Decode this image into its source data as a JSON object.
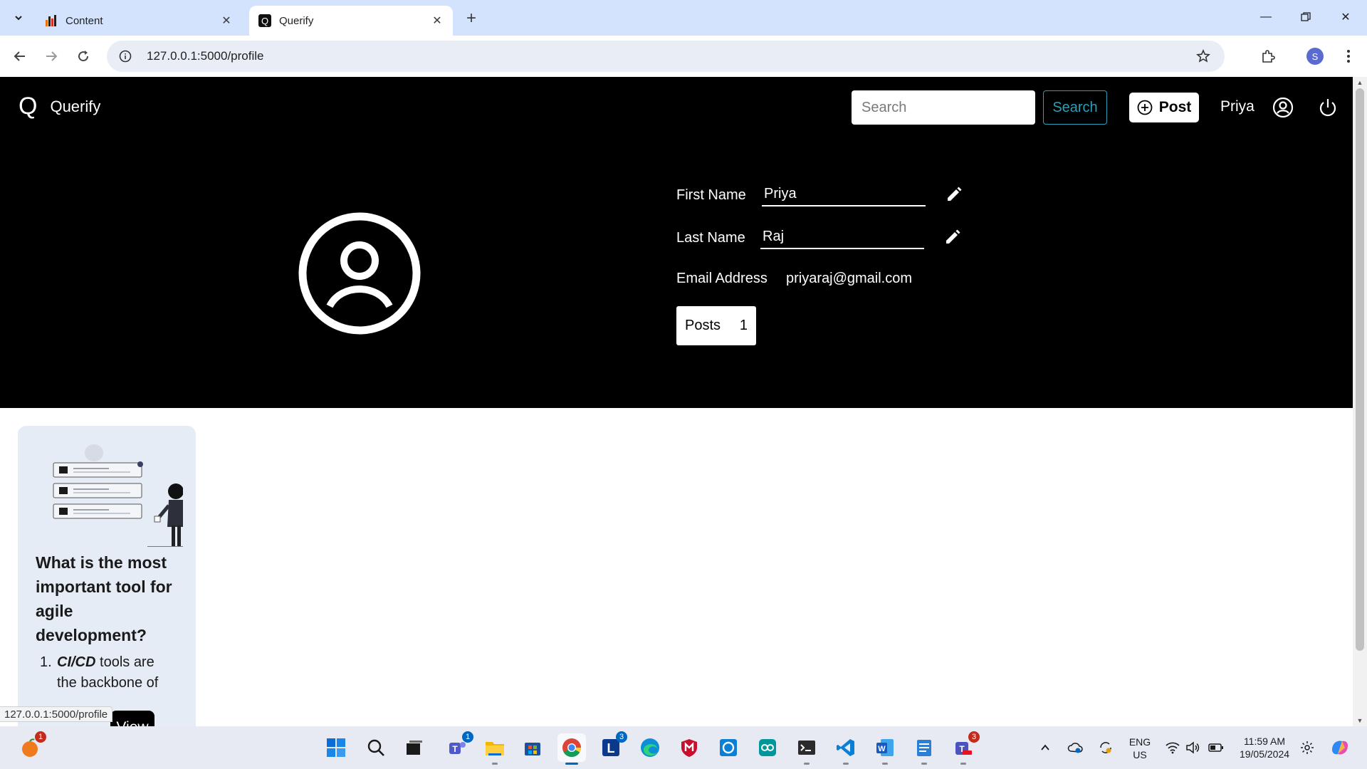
{
  "browser": {
    "tabs": [
      {
        "title": "Content",
        "icon": "bar-chart-icon"
      },
      {
        "title": "Querify",
        "icon": "querify-q-icon"
      }
    ],
    "url": "127.0.0.1:5000/profile",
    "profile_initial": "S",
    "status_url": "127.0.0.1:5000/profile"
  },
  "app": {
    "brand_logo": "Q",
    "brand_name": "Querify",
    "search_placeholder": "Search",
    "search_button": "Search",
    "post_button": "Post",
    "user_name": "Priya"
  },
  "profile": {
    "first_name_label": "First Name",
    "first_name": "Priya",
    "last_name_label": "Last Name",
    "last_name": "Raj",
    "email_label": "Email Address",
    "email": "priyaraj@gmail.com",
    "posts_label": "Posts",
    "posts_count": "1"
  },
  "card": {
    "title": "What is the most important tool for agile development?",
    "list_number": "1.",
    "list_bold": "CI/CD",
    "list_text": " tools are the backbone of",
    "view_button": "View"
  },
  "taskbar": {
    "lang_top": "ENG",
    "lang_bottom": "US",
    "time": "11:59 AM",
    "date": "19/05/2024",
    "badges": {
      "fruit": "1",
      "teams": "1",
      "l_app": "3",
      "teams2": "3"
    }
  },
  "colors": {
    "nav_bg": "#000000",
    "accent": "#2aa0b8",
    "card_bg": "#e6ecf5",
    "chrome_tabbar": "#d3e3fd"
  }
}
